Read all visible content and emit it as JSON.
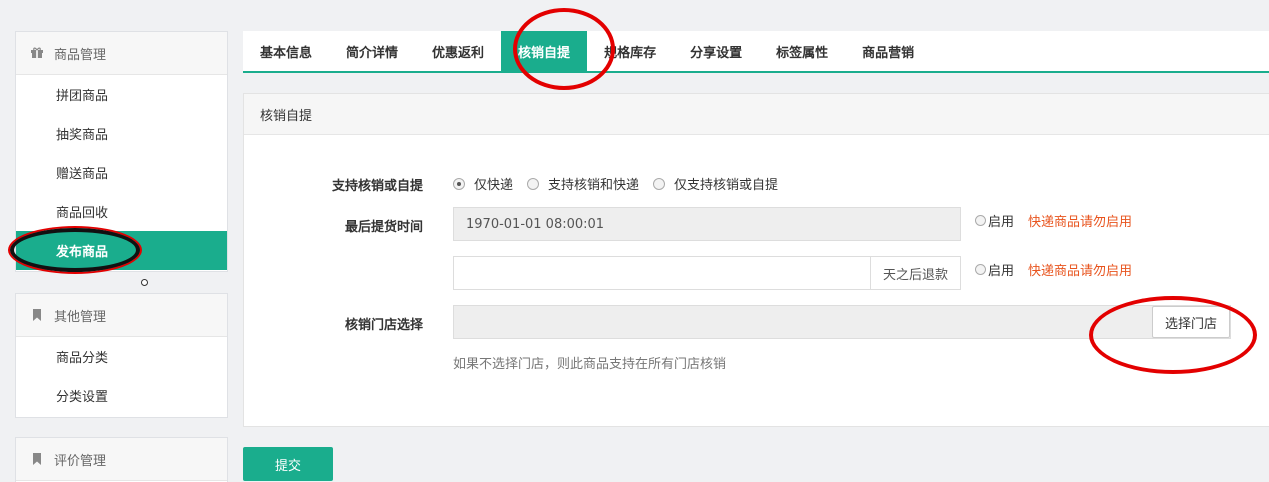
{
  "sidebar": {
    "groups": [
      {
        "title": "商品管理",
        "icon": "gift-icon",
        "items": [
          "拼团商品",
          "抽奖商品",
          "赠送商品",
          "商品回收",
          "发布商品"
        ],
        "active_index": 4
      },
      {
        "title": "其他管理",
        "icon": "bookmark-icon",
        "items": [
          "商品分类",
          "分类设置"
        ]
      },
      {
        "title": "评价管理",
        "icon": "bookmark-icon",
        "items": []
      }
    ]
  },
  "tabs": [
    "基本信息",
    "简介详情",
    "优惠返利",
    "核销自提",
    "规格库存",
    "分享设置",
    "标签属性",
    "商品营销"
  ],
  "active_tab_index": 3,
  "panel": {
    "title": "核销自提",
    "support_label": "支持核销或自提",
    "options": [
      "仅快递",
      "支持核销和快递",
      "仅支持核销或自提"
    ],
    "selected_option_index": 0,
    "last_pickup_label": "最后提货时间",
    "last_pickup_value": "1970-01-01 08:00:01",
    "enable_label": "启用",
    "warning_text": "快递商品请勿启用",
    "refund_days_value": "",
    "refund_days_addon": "天之后退款",
    "store_label": "核销门店选择",
    "store_value": "",
    "store_button": "选择门店",
    "help_text": "如果不选择门店，则此商品支持在所有门店核销"
  },
  "submit_label": "提交",
  "colors": {
    "accent": "#1aad8d",
    "warning": "#e8541e",
    "annotation_red": "#e30000",
    "annotation_black": "#000000"
  }
}
